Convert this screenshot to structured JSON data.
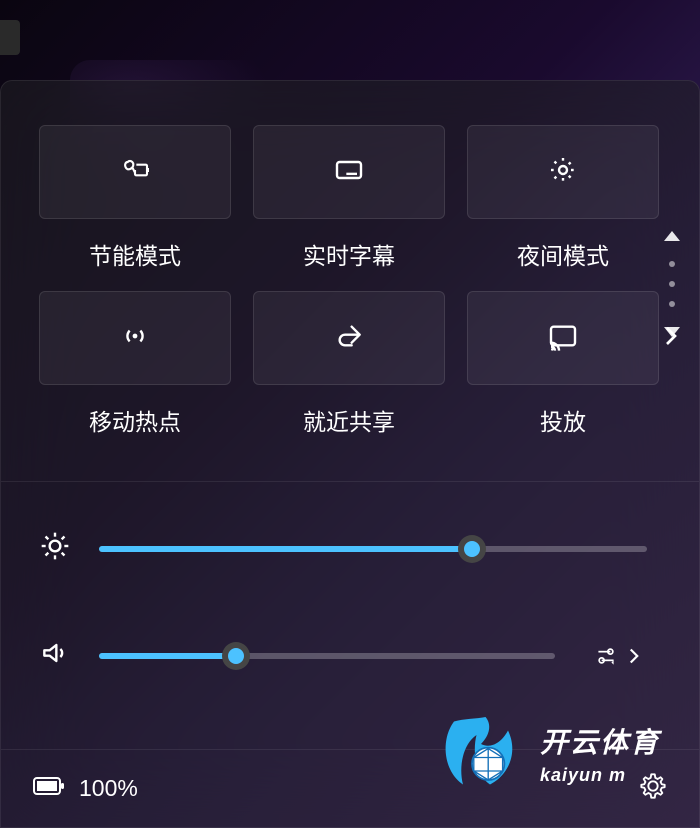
{
  "tiles": [
    {
      "label": "节能模式",
      "icon": "leaf-battery"
    },
    {
      "label": "实时字幕",
      "icon": "caption"
    },
    {
      "label": "夜间模式",
      "icon": "night-light"
    },
    {
      "label": "移动热点",
      "icon": "hotspot"
    },
    {
      "label": "就近共享",
      "icon": "share"
    },
    {
      "label": "投放",
      "icon": "cast",
      "expandable": true
    }
  ],
  "sliders": {
    "brightness": {
      "percent": 68
    },
    "volume": {
      "percent": 30
    }
  },
  "footer": {
    "battery_label": "100%"
  },
  "watermark": {
    "text_cn": "开云体育",
    "text_en": "kaiyun m"
  }
}
